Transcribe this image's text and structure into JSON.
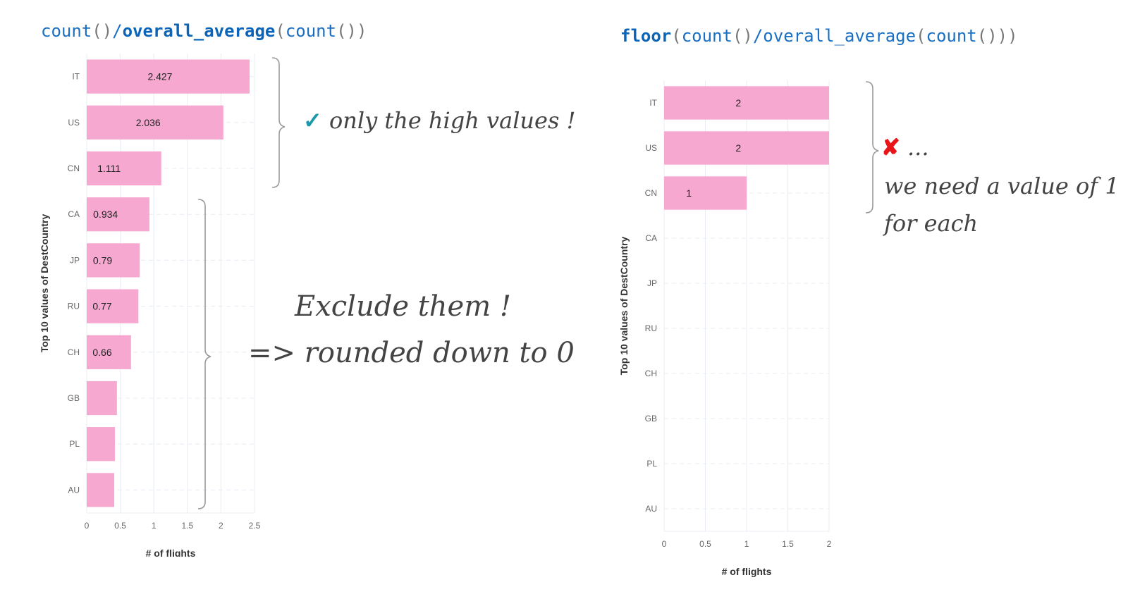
{
  "formulas": {
    "left": {
      "fn_outer": "count",
      "open1": "()",
      "slash": "/",
      "fn_bold": "overall_average",
      "open2": "(",
      "inner": "count",
      "close": "())"
    },
    "right": {
      "fn_bold": "floor",
      "open1": "(",
      "fn1": "count",
      "p1": "()",
      "rest": "/overall_average",
      "open2": "(",
      "inner": "count",
      "close": "()))"
    }
  },
  "annotations": {
    "check_icon": "✓",
    "high_values": "only the high values !",
    "exclude": "Exclude them !",
    "rounded": "=> rounded down to 0",
    "cross_icon": "✘",
    "ellipsis": "...",
    "need_line1": "we need a value of 1",
    "need_line2": "for each"
  },
  "colors": {
    "bar": "#f6a8d0",
    "grid": "#e8ecf5",
    "accent_check": "#1a9aa8",
    "accent_cross": "#e8141a",
    "formula": "#1a6fc2"
  },
  "chart_data": [
    {
      "type": "bar",
      "orientation": "horizontal",
      "title": "count()/overall_average(count())",
      "categories": [
        "IT",
        "US",
        "CN",
        "CA",
        "JP",
        "RU",
        "CH",
        "GB",
        "PL",
        "AU"
      ],
      "values": [
        2.427,
        2.036,
        1.111,
        0.934,
        0.79,
        0.77,
        0.66,
        0.45,
        0.42,
        0.41
      ],
      "data_labels": [
        "2.427",
        "2.036",
        "1.111",
        "0.934",
        "0.79",
        "0.77",
        "0.66",
        "",
        "",
        ""
      ],
      "xlabel": "# of flights",
      "ylabel": "Top 10 values of DestCountry",
      "xlim": [
        0,
        2.5
      ],
      "xticks": [
        "0",
        "0.5",
        "1",
        "1.5",
        "2",
        "2.5"
      ],
      "xtick_values": [
        0,
        0.5,
        1,
        1.5,
        2,
        2.5
      ],
      "grid": true
    },
    {
      "type": "bar",
      "orientation": "horizontal",
      "title": "floor(count()/overall_average(count()))",
      "categories": [
        "IT",
        "US",
        "CN",
        "CA",
        "JP",
        "RU",
        "CH",
        "GB",
        "PL",
        "AU"
      ],
      "values": [
        2,
        2,
        1,
        0,
        0,
        0,
        0,
        0,
        0,
        0
      ],
      "data_labels": [
        "2",
        "2",
        "1",
        "",
        "",
        "",
        "",
        "",
        "",
        ""
      ],
      "xlabel": "# of flights",
      "ylabel": "Top 10 values of DestCountry",
      "xlim": [
        0,
        2
      ],
      "xticks": [
        "0",
        "0.5",
        "1",
        "1.5",
        "2"
      ],
      "xtick_values": [
        0,
        0.5,
        1,
        1.5,
        2
      ],
      "grid": true
    }
  ]
}
